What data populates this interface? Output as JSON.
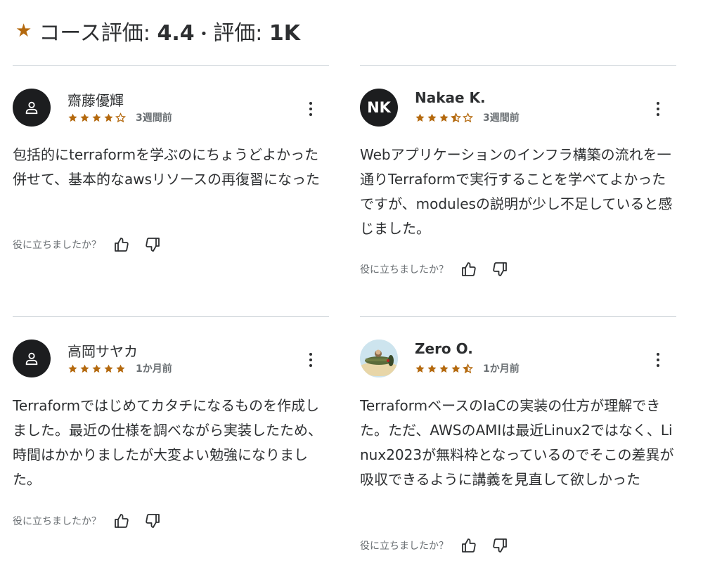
{
  "header": {
    "rating_label": "コース評価: ",
    "rating_value": "4.4",
    "separator": "•",
    "count_label": "評価: ",
    "count_value": "1K"
  },
  "colors": {
    "star": "#b4690e",
    "avatar_bg": "#1c1d1f",
    "divider": "#d1d7dc",
    "muted": "#6a6f73"
  },
  "reviews": [
    {
      "name": "齋藤優輝",
      "avatar": "person-icon",
      "stars": 4,
      "date": "3週間前",
      "text": "包括的にterraformを学ぶのにちょうどよかった併せて、基本的なawsリソースの再復習になった",
      "helpful": "役に立ちましたか？"
    },
    {
      "name": "Nakae K.",
      "avatar": "NK",
      "stars": 3.5,
      "date": "3週間前",
      "text": "Webアプリケーションのインフラ構築の流れを一通りTerraformで実行することを学べてよかったですが、modulesの説明が少し不足していると感じました。",
      "helpful": "役に立ちましたか？"
    },
    {
      "name": "高岡サヤカ",
      "avatar": "person-icon",
      "stars": 5,
      "date": "1か月前",
      "text": "Terraformではじめてカタチになるものを作成しました。最近の仕様を調べながら実装したため、時間はかかりましたが大変よい勉強になりました。",
      "helpful": "役に立ちましたか？"
    },
    {
      "name": "Zero O.",
      "avatar": "airplane-photo",
      "stars": 4.5,
      "date": "1か月前",
      "text": "TerraformベースのIaCの実装の仕方が理解できた。ただ、AWSのAMIは最近Linux2ではなく、Linux2023が無料枠となっているのでそこの差異が吸収できるように講義を見直して欲しかった",
      "helpful": "役に立ちましたか？"
    }
  ]
}
